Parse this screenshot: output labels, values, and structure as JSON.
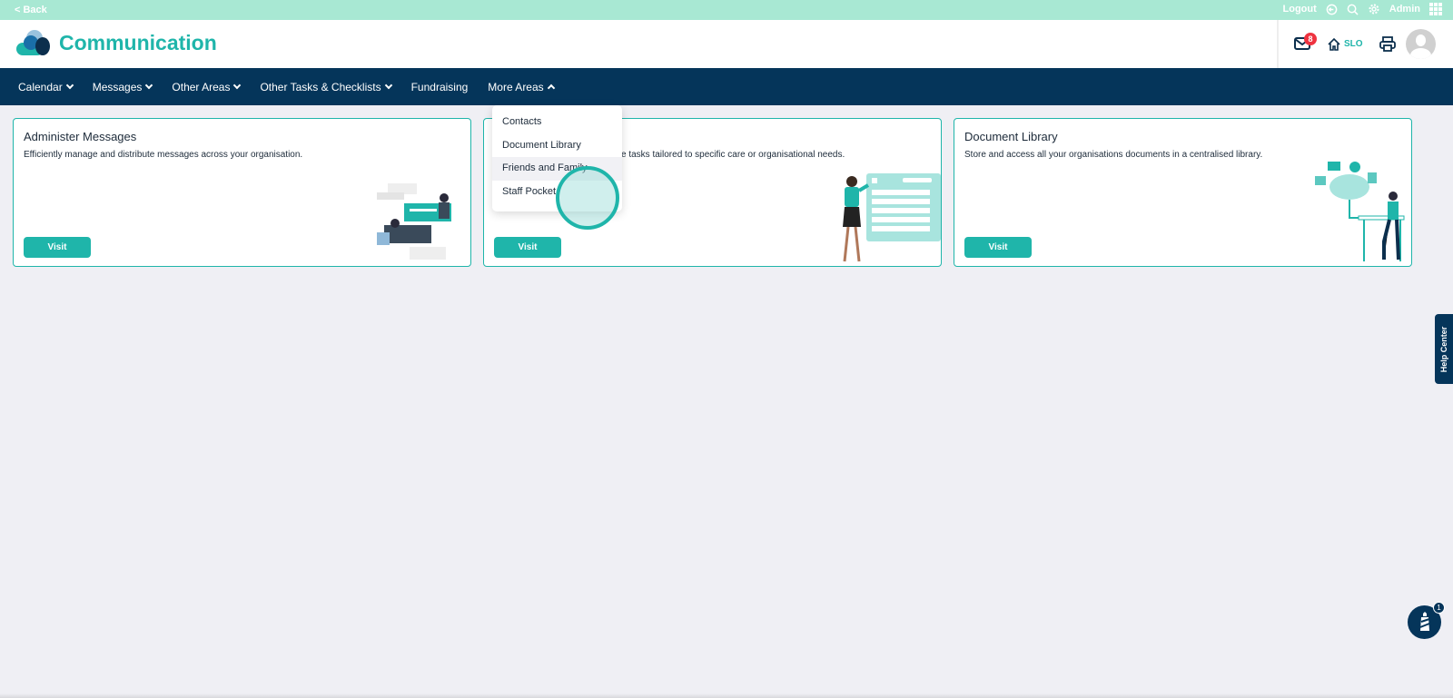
{
  "topbar": {
    "back": "< Back",
    "logout": "Logout",
    "user": "Admin"
  },
  "header": {
    "title": "Communication",
    "mail_count": "8",
    "home_label": "SLO"
  },
  "nav": {
    "items": [
      {
        "label": "Calendar",
        "chevron": "down"
      },
      {
        "label": "Messages",
        "chevron": "down"
      },
      {
        "label": "Other Areas",
        "chevron": "down"
      },
      {
        "label": "Other Tasks & Checklists",
        "chevron": "down"
      },
      {
        "label": "Fundraising",
        "chevron": ""
      },
      {
        "label": "More Areas",
        "chevron": "up"
      }
    ]
  },
  "dropdown": {
    "items": [
      "Contacts",
      "Document Library",
      "Friends and Family",
      "Staff Pocket"
    ]
  },
  "cards": [
    {
      "title": "Administer Messages",
      "description": "Efficiently manage and distribute messages across your organisation.",
      "button": "Visit"
    },
    {
      "description_visible": "e tasks tailored to specific care or organisational needs.",
      "button": "Visit"
    },
    {
      "title": "Document Library",
      "description": "Store and access all your organisations documents in a centralised library.",
      "button": "Visit"
    }
  ],
  "help": "Help Center",
  "chat_count": "1",
  "colors": {
    "accent": "#1fb5aa",
    "nav": "#05355a",
    "topbar": "#a8e8d3",
    "badge": "#ee3340"
  }
}
